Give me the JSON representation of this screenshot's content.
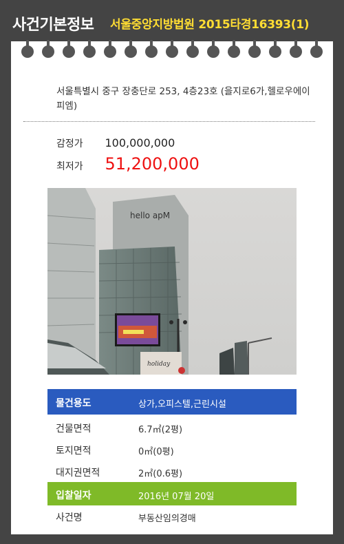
{
  "header": {
    "title": "사건기본정보",
    "case_info": "서울중앙지방법원 2015타경16393(1)",
    "title_color": "#ffffff",
    "case_color": "#ffdd33"
  },
  "property": {
    "address": "서울특별시 중구 장충단로 253, 4층23호 (을지로6가,헬로우에이피엠)"
  },
  "prices": {
    "appraisal_label": "감정가",
    "appraisal_value": "100,000,000",
    "minimum_label": "최저가",
    "minimum_value": "51,200,000",
    "minimum_color": "#ee1111"
  },
  "photo": {
    "sign_text": "hello apM",
    "banner_text": "holiday"
  },
  "details": [
    {
      "label": "물건용도",
      "value": "상가,오피스텔,근린시설",
      "style": "blue"
    },
    {
      "label": "건물면적",
      "value": "6.7㎡(2평)",
      "style": "plain"
    },
    {
      "label": "토지면적",
      "value": "0㎡(0평)",
      "style": "plain"
    },
    {
      "label": "대지권면적",
      "value": "2㎡(0.6평)",
      "style": "plain"
    },
    {
      "label": "입찰일자",
      "value": "2016년 07월 20일",
      "style": "green"
    },
    {
      "label": "사건명",
      "value": "부동산임의경매",
      "style": "plain"
    }
  ],
  "colors": {
    "background": "#444444",
    "accent_blue": "#2a5bbf",
    "accent_green": "#7fba28"
  }
}
